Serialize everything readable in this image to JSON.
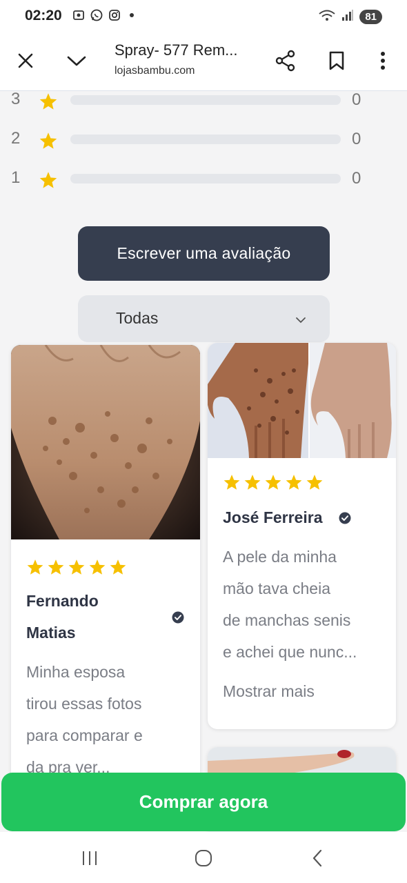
{
  "status_bar": {
    "time": "02:20",
    "battery": "81",
    "icons": [
      "screenshot-icon",
      "whatsapp-icon",
      "instagram-icon",
      "dot-icon",
      "wifi-icon",
      "signal-icon"
    ]
  },
  "browser": {
    "title": "Spray- 577 Rem...",
    "url": "lojasbambu.com",
    "icons": [
      "close-icon",
      "chevron-down-icon",
      "share-icon",
      "bookmark-icon",
      "more-vert-icon"
    ]
  },
  "ratings": [
    {
      "stars": "3",
      "count": "0",
      "fraction": 0
    },
    {
      "stars": "2",
      "count": "0",
      "fraction": 0
    },
    {
      "stars": "1",
      "count": "0",
      "fraction": 0
    }
  ],
  "write_review_label": "Escrever uma avaliação",
  "filter": {
    "value": "Todas"
  },
  "reviews": [
    {
      "name_line1": "Fernando",
      "name_line2": "Matias",
      "rating": 5,
      "text_lines": [
        "Minha esposa",
        "tirou essas fotos",
        "para comparar e",
        "da pra ver..."
      ]
    },
    {
      "name": "José Ferreira",
      "rating": 5,
      "text_lines": [
        "A pele da minha",
        "mão tava cheia",
        "de manchas senis",
        "e achei que nunc..."
      ],
      "show_more": "Mostrar mais"
    }
  ],
  "buy_label": "Comprar agora",
  "colors": {
    "star": "#f6c000",
    "dark_button": "#363e4f",
    "buy_button": "#22c55e",
    "verified": "#363e4f"
  }
}
